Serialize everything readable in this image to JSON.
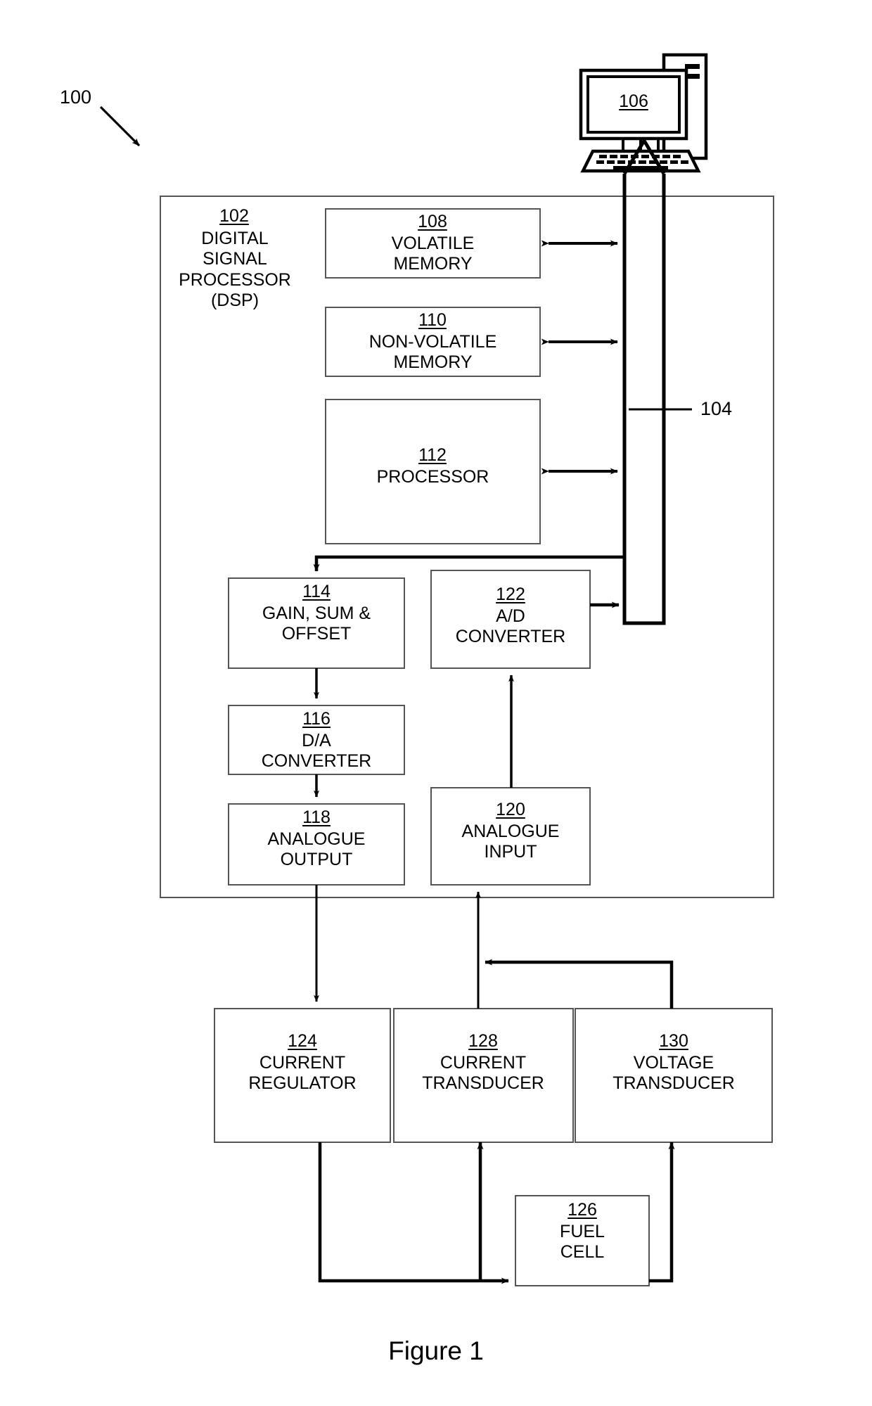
{
  "figure": {
    "caption": "Figure 1",
    "system_ref": "100",
    "bus_ref": "104"
  },
  "computer": {
    "ref": "106",
    "icon": "desktop-computer-icon"
  },
  "dsp": {
    "ref": "102",
    "label": "DIGITAL\nSIGNAL\nPROCESSOR\n(DSP)"
  },
  "blocks": [
    {
      "id": "volatile-memory",
      "ref": "108",
      "label": "VOLATILE\nMEMORY"
    },
    {
      "id": "non-volatile-memory",
      "ref": "110",
      "label": "NON-VOLATILE\nMEMORY"
    },
    {
      "id": "processor",
      "ref": "112",
      "label": "PROCESSOR"
    },
    {
      "id": "gain-sum-offset",
      "ref": "114",
      "label": "GAIN, SUM &\nOFFSET"
    },
    {
      "id": "da-converter",
      "ref": "116",
      "label": "D/A\nCONVERTER"
    },
    {
      "id": "analogue-output",
      "ref": "118",
      "label": "ANALOGUE\nOUTPUT"
    },
    {
      "id": "analogue-input",
      "ref": "120",
      "label": "ANALOGUE\nINPUT"
    },
    {
      "id": "ad-converter",
      "ref": "122",
      "label": "A/D\nCONVERTER"
    },
    {
      "id": "current-regulator",
      "ref": "124",
      "label": "CURRENT\nREGULATOR"
    },
    {
      "id": "fuel-cell",
      "ref": "126",
      "label": "FUEL\nCELL"
    },
    {
      "id": "current-transducer",
      "ref": "128",
      "label": "CURRENT\nTRANSDUCER"
    },
    {
      "id": "voltage-transducer",
      "ref": "130",
      "label": "VOLTAGE\nTRANSDUCER"
    }
  ],
  "colors": {
    "stroke": "#000000",
    "box_stroke": "#555555",
    "background": "#ffffff"
  },
  "chart_data": {
    "type": "diagram",
    "title": "Figure 1",
    "nodes": [
      {
        "ref": "100",
        "label": "system (lead line)"
      },
      {
        "ref": "102",
        "label": "DIGITAL SIGNAL PROCESSOR (DSP)"
      },
      {
        "ref": "104",
        "label": "bus"
      },
      {
        "ref": "106",
        "label": "computer"
      },
      {
        "ref": "108",
        "label": "VOLATILE MEMORY"
      },
      {
        "ref": "110",
        "label": "NON-VOLATILE MEMORY"
      },
      {
        "ref": "112",
        "label": "PROCESSOR"
      },
      {
        "ref": "114",
        "label": "GAIN, SUM & OFFSET"
      },
      {
        "ref": "116",
        "label": "D/A CONVERTER"
      },
      {
        "ref": "118",
        "label": "ANALOGUE OUTPUT"
      },
      {
        "ref": "120",
        "label": "ANALOGUE INPUT"
      },
      {
        "ref": "122",
        "label": "A/D CONVERTER"
      },
      {
        "ref": "124",
        "label": "CURRENT REGULATOR"
      },
      {
        "ref": "126",
        "label": "FUEL CELL"
      },
      {
        "ref": "128",
        "label": "CURRENT TRANSDUCER"
      },
      {
        "ref": "130",
        "label": "VOLTAGE TRANSDUCER"
      }
    ],
    "edges": [
      {
        "from": "108",
        "to": "104",
        "type": "bidirectional"
      },
      {
        "from": "110",
        "to": "104",
        "type": "bidirectional"
      },
      {
        "from": "112",
        "to": "104",
        "type": "bidirectional"
      },
      {
        "from": "104",
        "to": "106",
        "type": "directed"
      },
      {
        "from": "104",
        "to": "114",
        "type": "directed"
      },
      {
        "from": "114",
        "to": "116",
        "type": "directed"
      },
      {
        "from": "116",
        "to": "118",
        "type": "directed"
      },
      {
        "from": "118",
        "to": "124",
        "type": "directed"
      },
      {
        "from": "122",
        "to": "104",
        "type": "directed"
      },
      {
        "from": "120",
        "to": "122",
        "type": "directed"
      },
      {
        "from": "128",
        "to": "120",
        "type": "directed"
      },
      {
        "from": "130",
        "to": "120",
        "type": "directed"
      },
      {
        "from": "124",
        "to": "126",
        "type": "directed"
      },
      {
        "from": "126",
        "to": "128",
        "type": "directed"
      },
      {
        "from": "126",
        "to": "130",
        "type": "directed"
      }
    ]
  }
}
